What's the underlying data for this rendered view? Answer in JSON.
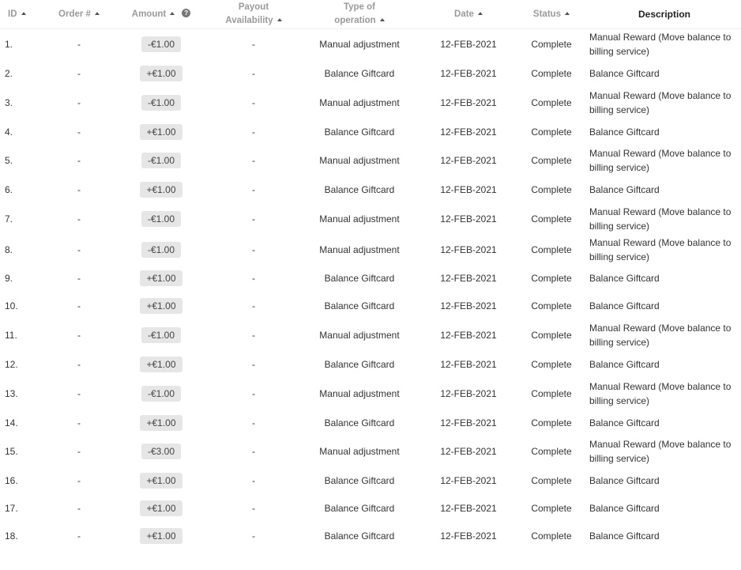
{
  "table": {
    "columns": {
      "id": "ID",
      "order": "Order #",
      "amount": "Amount",
      "payout_line1": "Payout",
      "payout_line2": "Availability",
      "type_line1": "Type of",
      "type_line2": "operation",
      "date": "Date",
      "status": "Status",
      "description": "Description"
    },
    "rows": [
      {
        "id": "1.",
        "order": "-",
        "amount": "-€1.00",
        "payout": "-",
        "type": "Manual adjustment",
        "date": "12-FEB-2021",
        "status": "Complete",
        "description": "Manual Reward (Move balance to billing service)"
      },
      {
        "id": "2.",
        "order": "-",
        "amount": "+€1.00",
        "payout": "-",
        "type": "Balance Giftcard",
        "date": "12-FEB-2021",
        "status": "Complete",
        "description": "Balance Giftcard"
      },
      {
        "id": "3.",
        "order": "-",
        "amount": "-€1.00",
        "payout": "-",
        "type": "Manual adjustment",
        "date": "12-FEB-2021",
        "status": "Complete",
        "description": "Manual Reward (Move balance to billing service)"
      },
      {
        "id": "4.",
        "order": "-",
        "amount": "+€1.00",
        "payout": "-",
        "type": "Balance Giftcard",
        "date": "12-FEB-2021",
        "status": "Complete",
        "description": "Balance Giftcard"
      },
      {
        "id": "5.",
        "order": "-",
        "amount": "-€1.00",
        "payout": "-",
        "type": "Manual adjustment",
        "date": "12-FEB-2021",
        "status": "Complete",
        "description": "Manual Reward (Move balance to billing service)"
      },
      {
        "id": "6.",
        "order": "-",
        "amount": "+€1.00",
        "payout": "-",
        "type": "Balance Giftcard",
        "date": "12-FEB-2021",
        "status": "Complete",
        "description": "Balance Giftcard"
      },
      {
        "id": "7.",
        "order": "-",
        "amount": "-€1.00",
        "payout": "-",
        "type": "Manual adjustment",
        "date": "12-FEB-2021",
        "status": "Complete",
        "description": "Manual Reward (Move balance to billing service)"
      },
      {
        "id": "8.",
        "order": "-",
        "amount": "-€1.00",
        "payout": "-",
        "type": "Manual adjustment",
        "date": "12-FEB-2021",
        "status": "Complete",
        "description": "Manual Reward (Move balance to billing service)"
      },
      {
        "id": "9.",
        "order": "-",
        "amount": "+€1.00",
        "payout": "-",
        "type": "Balance Giftcard",
        "date": "12-FEB-2021",
        "status": "Complete",
        "description": "Balance Giftcard"
      },
      {
        "id": "10.",
        "order": "-",
        "amount": "+€1.00",
        "payout": "-",
        "type": "Balance Giftcard",
        "date": "12-FEB-2021",
        "status": "Complete",
        "description": "Balance Giftcard"
      },
      {
        "id": "11.",
        "order": "-",
        "amount": "-€1.00",
        "payout": "-",
        "type": "Manual adjustment",
        "date": "12-FEB-2021",
        "status": "Complete",
        "description": "Manual Reward (Move balance to billing service)"
      },
      {
        "id": "12.",
        "order": "-",
        "amount": "+€1.00",
        "payout": "-",
        "type": "Balance Giftcard",
        "date": "12-FEB-2021",
        "status": "Complete",
        "description": "Balance Giftcard"
      },
      {
        "id": "13.",
        "order": "-",
        "amount": "-€1.00",
        "payout": "-",
        "type": "Manual adjustment",
        "date": "12-FEB-2021",
        "status": "Complete",
        "description": "Manual Reward (Move balance to billing service)"
      },
      {
        "id": "14.",
        "order": "-",
        "amount": "+€1.00",
        "payout": "-",
        "type": "Balance Giftcard",
        "date": "12-FEB-2021",
        "status": "Complete",
        "description": "Balance Giftcard"
      },
      {
        "id": "15.",
        "order": "-",
        "amount": "-€3.00",
        "payout": "-",
        "type": "Manual adjustment",
        "date": "12-FEB-2021",
        "status": "Complete",
        "description": "Manual Reward (Move balance to billing service)"
      },
      {
        "id": "16.",
        "order": "-",
        "amount": "+€1.00",
        "payout": "-",
        "type": "Balance Giftcard",
        "date": "12-FEB-2021",
        "status": "Complete",
        "description": "Balance Giftcard"
      },
      {
        "id": "17.",
        "order": "-",
        "amount": "+€1.00",
        "payout": "-",
        "type": "Balance Giftcard",
        "date": "12-FEB-2021",
        "status": "Complete",
        "description": "Balance Giftcard"
      },
      {
        "id": "18.",
        "order": "-",
        "amount": "+€1.00",
        "payout": "-",
        "type": "Balance Giftcard",
        "date": "12-FEB-2021",
        "status": "Complete",
        "description": "Balance Giftcard"
      }
    ]
  },
  "icons": {
    "sort": "sort-ascending-icon",
    "help": "help-icon"
  }
}
